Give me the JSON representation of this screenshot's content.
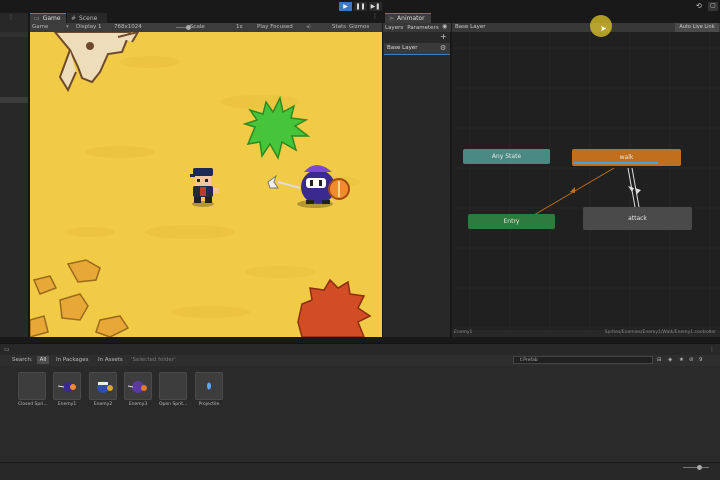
{
  "toolbar": {
    "play_icon": "▶",
    "pause_icon": "❚❚",
    "step_icon": "▶❚",
    "history_icon": "⟲",
    "layout_icon": "▢"
  },
  "tabs": {
    "game": "Game",
    "scene": "Scene",
    "animator": "Animator"
  },
  "game_controls": {
    "view": "Game",
    "display": "Display 1",
    "resolution": "768x1024",
    "scale_label": "Scale",
    "scale_value": "1x",
    "play_focused": "Play Focused",
    "stats": "Stats",
    "gizmos": "Gizmos"
  },
  "animator": {
    "subtabs": [
      "Layers",
      "Parameters"
    ],
    "layer_name": "Base Layer",
    "breadcrumb": "Base Layer",
    "auto_live_link": "Auto Live Link",
    "states": {
      "any": "Any State",
      "walk": "walk",
      "entry": "Entry",
      "attack": "attack"
    },
    "footer_left": "Enemy1",
    "footer_right": "Sprites/Enemies/Enemy1/Walk/Enemy1.controller"
  },
  "project": {
    "search_label": "Search:",
    "search_all": "All",
    "in_packages": "In Packages",
    "in_assets": "In Assets",
    "selected_folder": "'Selected folder'",
    "search_value": "t:Prefab",
    "count": "9",
    "assets": [
      "Closed Spri...",
      "Enemy1",
      "Enemy2",
      "Enemy3",
      "Open Sprit...",
      "Projectile"
    ]
  },
  "colors": {
    "play_active": "#3a79bb",
    "sand": "#f1ca46",
    "any_state": "#4a8a82",
    "walk_state": "#c0701c",
    "entry_state": "#2d7c3d",
    "attack_state": "#4a4a4a"
  }
}
